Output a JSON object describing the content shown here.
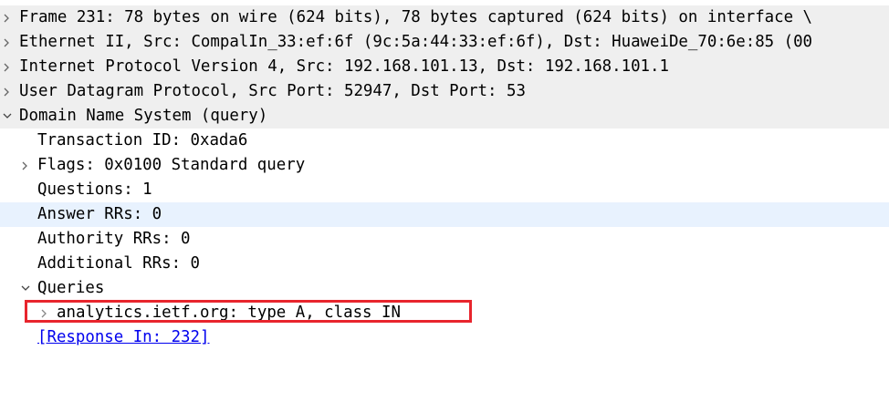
{
  "packet_tree": {
    "frame": "Frame 231: 78 bytes on wire (624 bits), 78 bytes captured (624 bits) on interface \\",
    "ethernet": "Ethernet II, Src: CompalIn_33:ef:6f (9c:5a:44:33:ef:6f), Dst: HuaweiDe_70:6e:85 (00",
    "ip": "Internet Protocol Version 4, Src: 192.168.101.13, Dst: 192.168.101.1",
    "udp": "User Datagram Protocol, Src Port: 52947, Dst Port: 53",
    "dns": "Domain Name System (query)",
    "transaction_id": "Transaction ID: 0xada6",
    "flags": "Flags: 0x0100 Standard query",
    "questions": "Questions: 1",
    "answer_rrs": "Answer RRs: 0",
    "authority_rrs": "Authority RRs: 0",
    "additional_rrs": "Additional RRs: 0",
    "queries": "Queries",
    "query_item": "analytics.ietf.org: type A, class IN",
    "response_in": "[Response In: 232]"
  },
  "colors": {
    "top_level_row_bg": "#efefef",
    "hover_row_bg": "#e8f2fe",
    "highlight_border": "#e8252d",
    "link": "#0000ee"
  },
  "icons": {
    "collapsed": "chevron-right-icon",
    "expanded": "chevron-down-icon"
  }
}
